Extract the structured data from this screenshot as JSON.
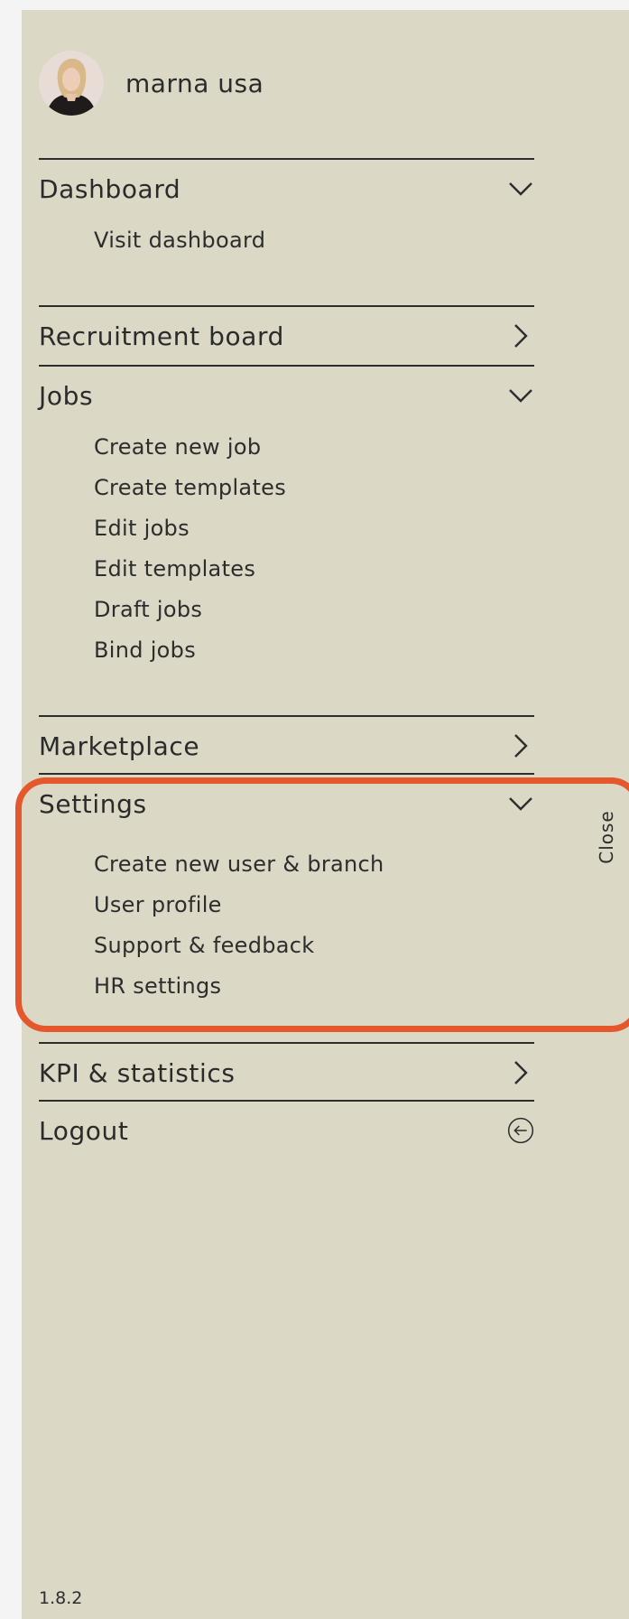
{
  "user": {
    "name": "marna usa"
  },
  "menu": {
    "dashboard": {
      "label": "Dashboard",
      "items": [
        "Visit dashboard"
      ]
    },
    "recruitment_board": {
      "label": "Recruitment board"
    },
    "jobs": {
      "label": "Jobs",
      "items": [
        "Create new job",
        "Create templates",
        "Edit jobs",
        "Edit templates",
        "Draft jobs",
        "Bind jobs"
      ]
    },
    "marketplace": {
      "label": "Marketplace"
    },
    "settings": {
      "label": "Settings",
      "items": [
        "Create new user & branch",
        "User profile",
        "Support & feedback",
        "HR settings"
      ]
    },
    "kpi": {
      "label": "KPI & statistics"
    },
    "logout": {
      "label": "Logout"
    }
  },
  "close_label": "Close",
  "version": "1.8.2",
  "colors": {
    "panel_bg": "#dbd8c6",
    "text": "#2d2d2d",
    "highlight": "#e5572c"
  }
}
